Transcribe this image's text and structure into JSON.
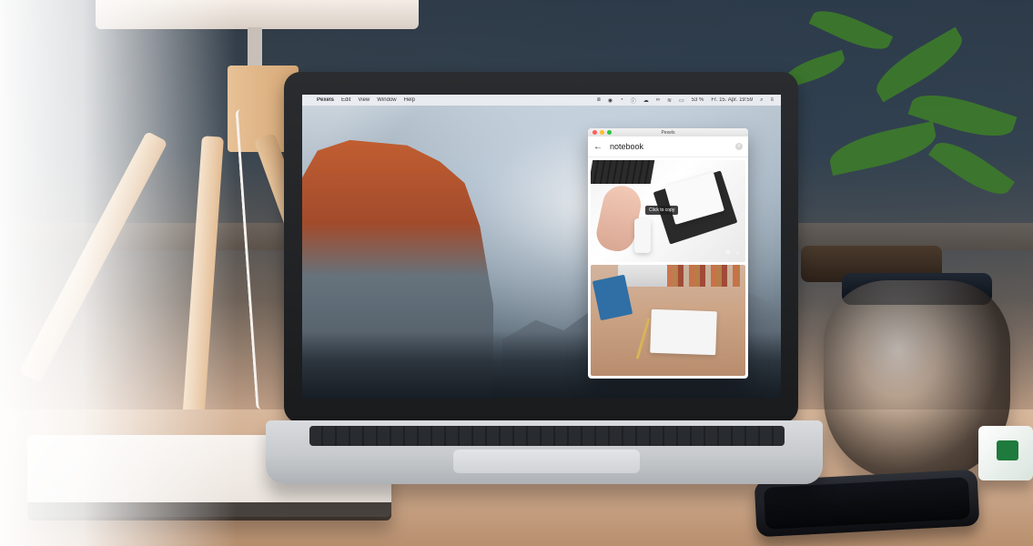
{
  "menubar": {
    "apple_icon": "",
    "app_name": "Pexels",
    "items": [
      "Edit",
      "View",
      "Window",
      "Help"
    ],
    "battery": "53 %",
    "datetime": "Fr. 15. Apr. 19:59"
  },
  "window": {
    "title": "Pexels",
    "search_query": "notebook",
    "tooltip": "Click to copy"
  },
  "icons": {
    "back": "back-arrow-icon",
    "clear": "clear-search-icon"
  }
}
